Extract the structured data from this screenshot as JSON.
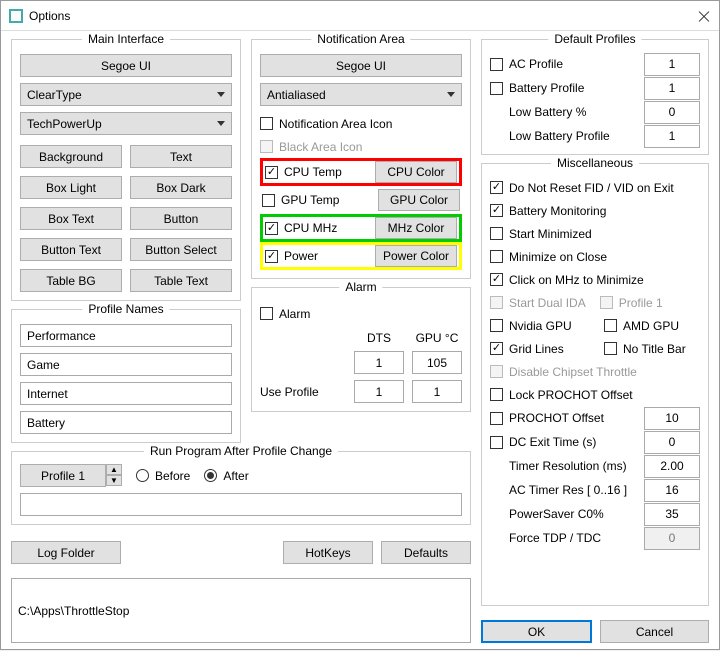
{
  "window": {
    "title": "Options"
  },
  "main_interface": {
    "label": "Main Interface",
    "font_btn": "Segoe UI",
    "render_select": "ClearType",
    "theme_select": "TechPowerUp",
    "buttons": [
      "Background",
      "Text",
      "Box Light",
      "Box Dark",
      "Box Text",
      "Button",
      "Button Text",
      "Button Select",
      "Table BG",
      "Table Text"
    ]
  },
  "profile_names": {
    "label": "Profile Names",
    "items": [
      "Performance",
      "Game",
      "Internet",
      "Battery"
    ]
  },
  "rpapc": {
    "label": "Run Program After Profile Change",
    "profile_select": "Profile 1",
    "before": "Before",
    "after": "After",
    "after_checked": true,
    "cmd": ""
  },
  "log_folder_btn": "Log Folder",
  "hotkeys_btn": "HotKeys",
  "defaults_btn": "Defaults",
  "path": "C:\\Apps\\ThrottleStop",
  "notification": {
    "label": "Notification Area",
    "font_btn": "Segoe UI",
    "render_select": "Antialiased",
    "area_icon": {
      "label": "Notification Area Icon",
      "checked": false
    },
    "black_icon": {
      "label": "Black Area Icon",
      "disabled": true
    },
    "rows": [
      {
        "label": "CPU Temp",
        "btn": "CPU Color",
        "checked": true,
        "hl": "red"
      },
      {
        "label": "GPU Temp",
        "btn": "GPU Color",
        "checked": false,
        "hl": ""
      },
      {
        "label": "CPU MHz",
        "btn": "MHz Color",
        "checked": true,
        "hl": "green"
      },
      {
        "label": "Power",
        "btn": "Power Color",
        "checked": true,
        "hl": "yellow"
      }
    ]
  },
  "alarm": {
    "label": "Alarm",
    "alarm_cb": "Alarm",
    "dts": "DTS",
    "gpuc": "GPU °C",
    "dts_val": "1",
    "gpuc_val": "105",
    "use_profile": "Use Profile",
    "up1": "1",
    "up2": "1"
  },
  "default_profiles": {
    "label": "Default Profiles",
    "rows": [
      {
        "lbl": "AC Profile",
        "val": "1",
        "cb": true,
        "checked": false
      },
      {
        "lbl": "Battery Profile",
        "val": "1",
        "cb": true,
        "checked": false
      },
      {
        "lbl": "Low Battery %",
        "val": "0",
        "cb": false
      },
      {
        "lbl": "Low Battery Profile",
        "val": "1",
        "cb": false
      }
    ]
  },
  "misc": {
    "label": "Miscellaneous",
    "items": [
      {
        "lbl": "Do Not Reset FID / VID on Exit",
        "checked": true
      },
      {
        "lbl": "Battery Monitoring",
        "checked": true
      },
      {
        "lbl": "Start Minimized",
        "checked": false
      },
      {
        "lbl": "Minimize on Close",
        "checked": false
      },
      {
        "lbl": "Click on MHz to Minimize",
        "checked": true
      }
    ],
    "dual_ida": {
      "lbl": "Start Dual IDA",
      "disabled": true
    },
    "profile1": {
      "lbl": "Profile 1",
      "disabled": true
    },
    "nvidia": {
      "lbl": "Nvidia GPU",
      "checked": false
    },
    "amd": {
      "lbl": "AMD GPU",
      "checked": false
    },
    "grid": {
      "lbl": "Grid Lines",
      "checked": true
    },
    "notitle": {
      "lbl": "No Title Bar",
      "checked": false
    },
    "chipset": {
      "lbl": "Disable Chipset Throttle",
      "disabled": true
    },
    "lockprochot": {
      "lbl": "Lock PROCHOT Offset",
      "checked": false
    },
    "prochot": {
      "lbl": "PROCHOT Offset",
      "checked": false,
      "val": "10"
    },
    "dcexit": {
      "lbl": "DC Exit Time (s)",
      "checked": false,
      "val": "0"
    },
    "timer_res": {
      "lbl": "Timer Resolution (ms)",
      "val": "2.00"
    },
    "ac_timer": {
      "lbl": "AC Timer Res [ 0..16 ]",
      "val": "16"
    },
    "powersaver": {
      "lbl": "PowerSaver C0%",
      "val": "35"
    },
    "forcetdp": {
      "lbl": "Force TDP / TDC",
      "val": "0",
      "ro": true
    }
  },
  "ok": "OK",
  "cancel": "Cancel"
}
